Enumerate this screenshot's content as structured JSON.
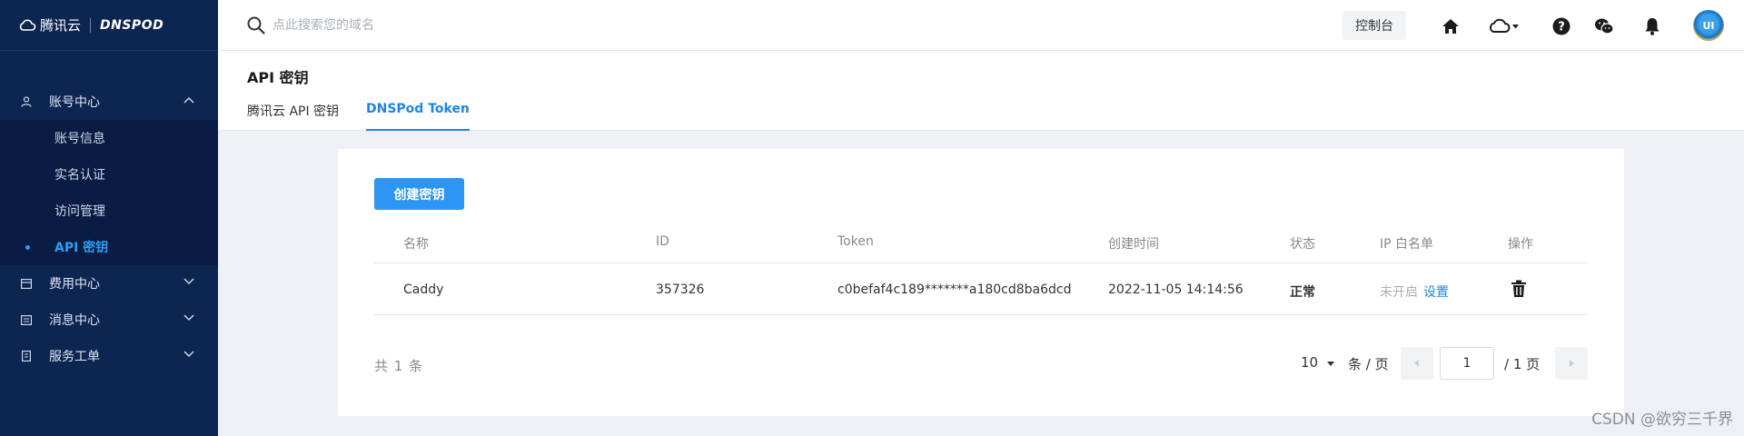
{
  "sidebar": {
    "brand_name": "腾讯云",
    "brand_product": "DNSPOD",
    "groups": [
      {
        "label": "账号中心",
        "expanded": true
      },
      {
        "label": "费用中心",
        "expanded": false
      },
      {
        "label": "消息中心",
        "expanded": false
      },
      {
        "label": "服务工单",
        "expanded": false
      }
    ],
    "sub_items": [
      "账号信息",
      "实名认证",
      "访问管理",
      "API 密钥"
    ],
    "active_sub_item": "API 密钥"
  },
  "topbar": {
    "search_placeholder": "点此搜索您的域名",
    "console_label": "控制台",
    "icons": [
      "home-icon",
      "cloud-dropdown-icon",
      "help-icon",
      "wechat-icon",
      "bell-icon"
    ],
    "avatar_text": "UI"
  },
  "page": {
    "title": "API 密钥",
    "tabs": [
      {
        "label": "腾讯云 API 密钥",
        "active": false
      },
      {
        "label": "DNSPod Token",
        "active": true
      }
    ]
  },
  "card": {
    "create_button": "创建密钥",
    "columns": [
      "名称",
      "ID",
      "Token",
      "创建时间",
      "状态",
      "IP 白名单",
      "操作"
    ],
    "rows": [
      {
        "name": "Caddy",
        "id": "357326",
        "token": "c0befaf4c189*******a180cd8ba6dcd",
        "created": "2022-11-05 14:14:56",
        "status": "正常",
        "whitelist_status": "未开启",
        "whitelist_action": "设置",
        "action_icon": "trash-icon"
      }
    ],
    "total_text": "共 1 条",
    "page_size": "10",
    "page_size_unit": "条 / 页",
    "current_page": "1",
    "total_pages_text": "/ 1 页"
  },
  "watermark": "CSDN @欲穷三千界",
  "colors": {
    "sidebar_bg": "#0d2551",
    "accent": "#1f84e6",
    "button": "#2d95f3"
  }
}
